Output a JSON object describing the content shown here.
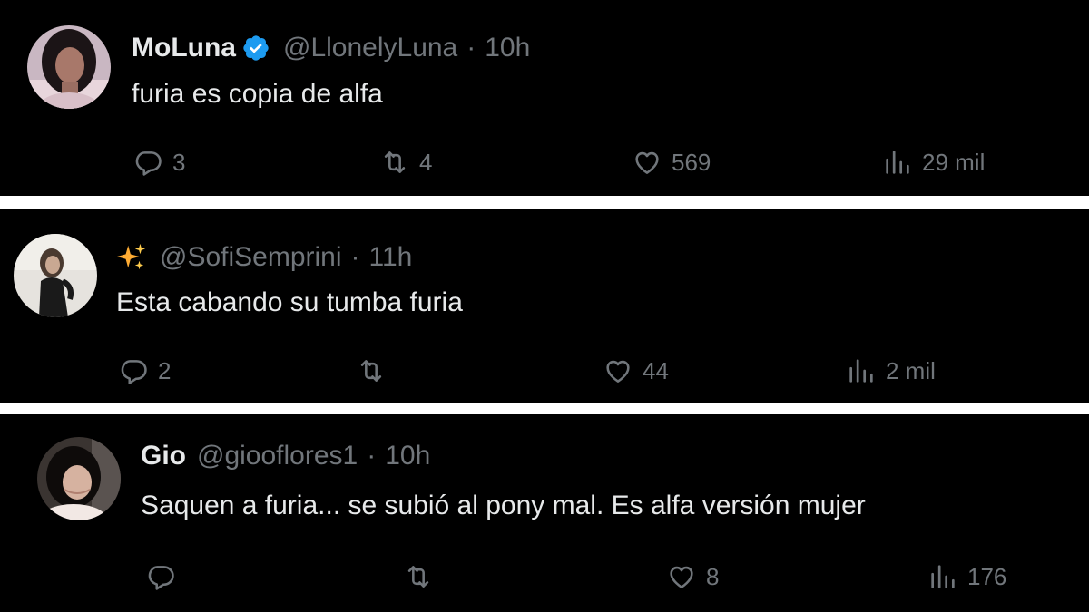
{
  "colors": {
    "background": "#000000",
    "text": "#e7e9ea",
    "muted": "#71767b",
    "verified": "#1d9bf0",
    "divider": "#ffffff"
  },
  "tweets": [
    {
      "name": "MoLuna",
      "verified": true,
      "handle": "@LlonelyLuna",
      "separator": "·",
      "time": "10h",
      "text": "furia es copia de alfa",
      "replies": "3",
      "retweets": "4",
      "likes": "569",
      "views": "29 mil"
    },
    {
      "name": "",
      "emoji": "sparkles-icon",
      "handle": "@SofiSemprini",
      "separator": "·",
      "time": "11h",
      "text": "Esta cabando su tumba furia",
      "replies": "2",
      "retweets": "",
      "likes": "44",
      "views": "2 mil"
    },
    {
      "name": "Gio",
      "verified": false,
      "handle": "@giooflores1",
      "separator": "·",
      "time": "10h",
      "text": "Saquen a furia... se subió al pony mal. Es alfa versión mujer",
      "replies": "",
      "retweets": "",
      "likes": "8",
      "views": "176"
    }
  ]
}
